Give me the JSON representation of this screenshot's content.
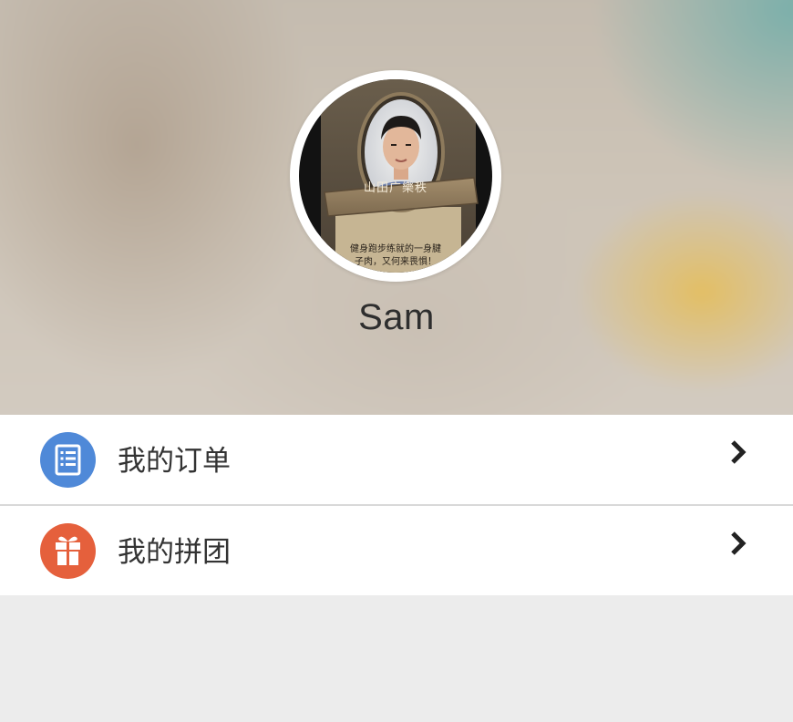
{
  "profile": {
    "username": "Sam",
    "avatar_card": {
      "banner_text": "山田广樂秩",
      "flavor_line1": "健身跑步练就的一身腱",
      "flavor_line2": "子肉，又何来畏惧！"
    }
  },
  "menu": {
    "items": [
      {
        "label": "我的订单",
        "icon": "order-list-icon",
        "icon_color": "#4f89d8"
      },
      {
        "label": "我的拼团",
        "icon": "gift-icon",
        "icon_color": "#e5603c"
      }
    ],
    "arrow_icon": "chevron-right-icon"
  },
  "colors": {
    "page_background": "#ececec",
    "text_primary": "#333333"
  }
}
